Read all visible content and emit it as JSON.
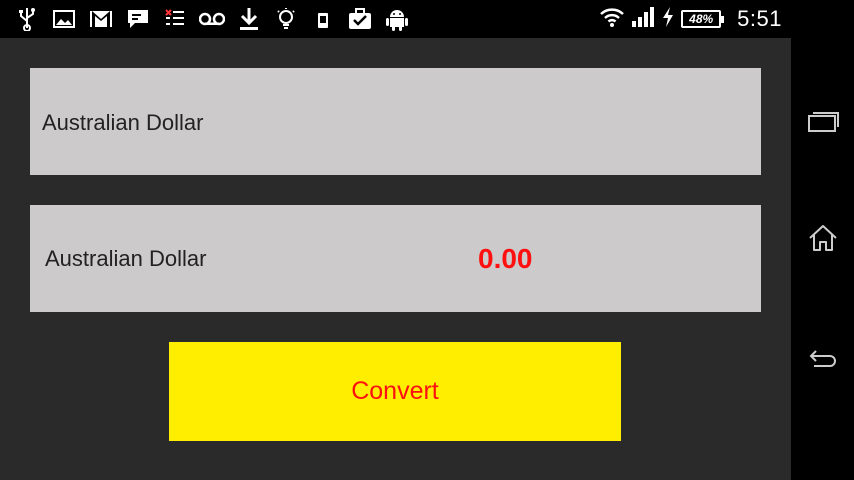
{
  "status_bar": {
    "icons": [
      "usb-icon",
      "image-icon",
      "gmail-icon",
      "chat-icon",
      "notes-icon",
      "voicemail-icon",
      "download-icon",
      "lightbulb-icon",
      "phone-device-icon",
      "briefcase-check-icon",
      "android-icon"
    ],
    "battery_percent": "48%",
    "time": "5:51"
  },
  "converter": {
    "from_currency": "Australian Dollar",
    "to_currency": "Australian Dollar",
    "result": "0.00",
    "convert_label": "Convert"
  },
  "colors": {
    "app_background": "#2a2a2a",
    "panel_background": "#cccaca",
    "button_background": "#ffee00",
    "accent_red": "#ff1010"
  },
  "nav_bar": {
    "buttons": [
      "recents-icon",
      "home-icon",
      "back-icon"
    ]
  }
}
